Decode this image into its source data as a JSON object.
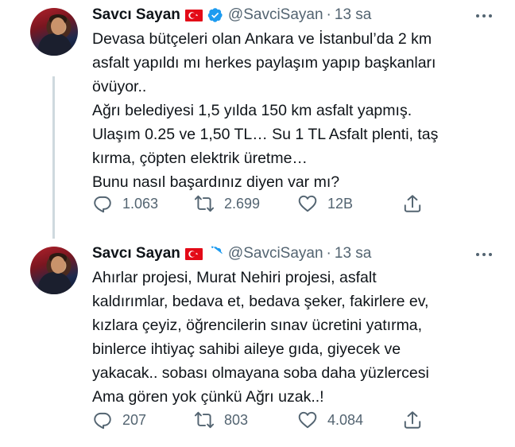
{
  "tweets": [
    {
      "author": {
        "name": "Savcı Sayan",
        "handle": "@SavciSayan",
        "flag_icon": "turkey-flag-icon",
        "verified_icon": "verified-badge-icon",
        "verified_color": "#1d9bf0"
      },
      "separator": "·",
      "time": "13 sa",
      "text_lines": [
        "Devasa bütçeleri olan Ankara ve İstanbul’da 2 km",
        "asfalt yapıldı mı herkes paylaşım yapıp başkanları",
        "övüyor..",
        "Ağrı belediyesi 1,5 yılda 150 km asfalt yapmış.",
        "Ulaşım 0.25 ve 1,50 TL… Su 1 TL Asfalt plenti, taş",
        "kırma, çöpten elektrik üretme…",
        "Bunu nasıl başardınız diyen var mı?"
      ],
      "stats": {
        "replies": "1.063",
        "retweets": "2.699",
        "likes": "12B"
      }
    },
    {
      "author": {
        "name": "Savcı Sayan",
        "handle": "@SavciSayan",
        "flag_icon": "turkey-flag-icon",
        "verified_icon": "verified-badge-icon",
        "verified_color": "#1d9bf0"
      },
      "separator": "·",
      "time": "13 sa",
      "text_lines": [
        "Ahırlar projesi, Murat Nehiri projesi, asfalt",
        "kaldırımlar, bedava et, bedava şeker, fakirlere ev,",
        "kızlara çeyiz, öğrencilerin sınav ücretini yatırma,",
        "binlerce ihtiyaç sahibi aileye gıda, giyecek ve",
        "yakacak.. sobası olmayana soba daha yüzlercesi",
        "Ama gören yok çünkü Ağrı uzak..!"
      ],
      "stats": {
        "replies": "207",
        "retweets": "803",
        "likes": "4.084"
      }
    }
  ],
  "icons": {
    "more": "more-options-icon",
    "reply": "reply-icon",
    "retweet": "retweet-icon",
    "like": "like-icon",
    "share": "share-icon"
  },
  "colors": {
    "text": "#0f1419",
    "secondary": "#536471",
    "flag_red": "#e30a17",
    "thread_line": "#cfd9de"
  }
}
